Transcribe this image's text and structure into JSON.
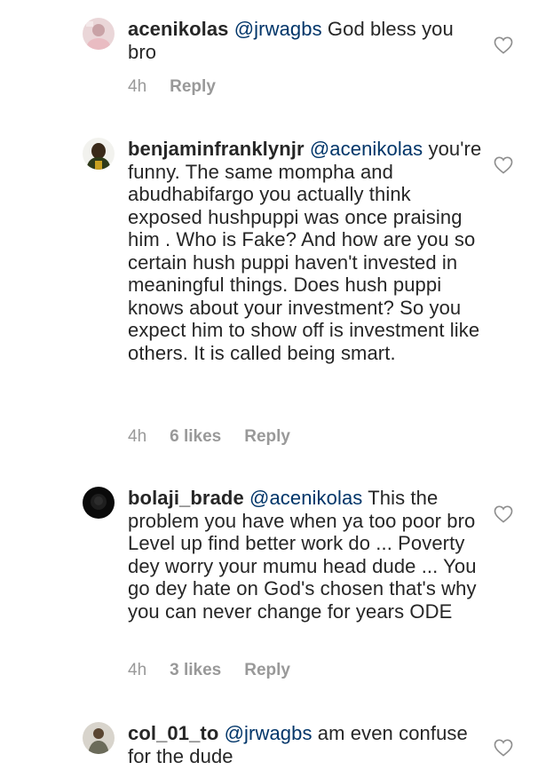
{
  "comments": [
    {
      "username": "acenikolas",
      "mention": "@jrwagbs",
      "text": "God bless you bro",
      "time": "4h",
      "likes": "",
      "reply": "Reply"
    },
    {
      "username": "benjaminfranklynjr",
      "mention": "@acenikolas",
      "text": "you're funny. The same mompha and abudhabifargo you actually think exposed hushpuppi was once praising him . Who is Fake? And how are you so certain hush puppi haven't invested in meaningful things. Does hush puppi knows about your investment? So you expect him to show off is investment like others. It is called being smart.",
      "time": "4h",
      "likes": "6 likes",
      "reply": "Reply"
    },
    {
      "username": "bolaji_brade",
      "mention": "@acenikolas",
      "text": "This the problem you have when ya too poor bro Level up find better work do ... Poverty dey worry your mumu head dude ... You go dey hate on God's chosen that's why you can never change for years ODE",
      "time": "4h",
      "likes": "3 likes",
      "reply": "Reply"
    },
    {
      "username": "col_01_to",
      "mention": "@jrwagbs",
      "text": "am even confuse for the dude",
      "time": "",
      "likes": "",
      "reply": ""
    }
  ],
  "icons": {
    "like": "heart-outline-icon"
  },
  "colors": {
    "text": "#262626",
    "mention": "#003569",
    "meta": "#999999"
  }
}
